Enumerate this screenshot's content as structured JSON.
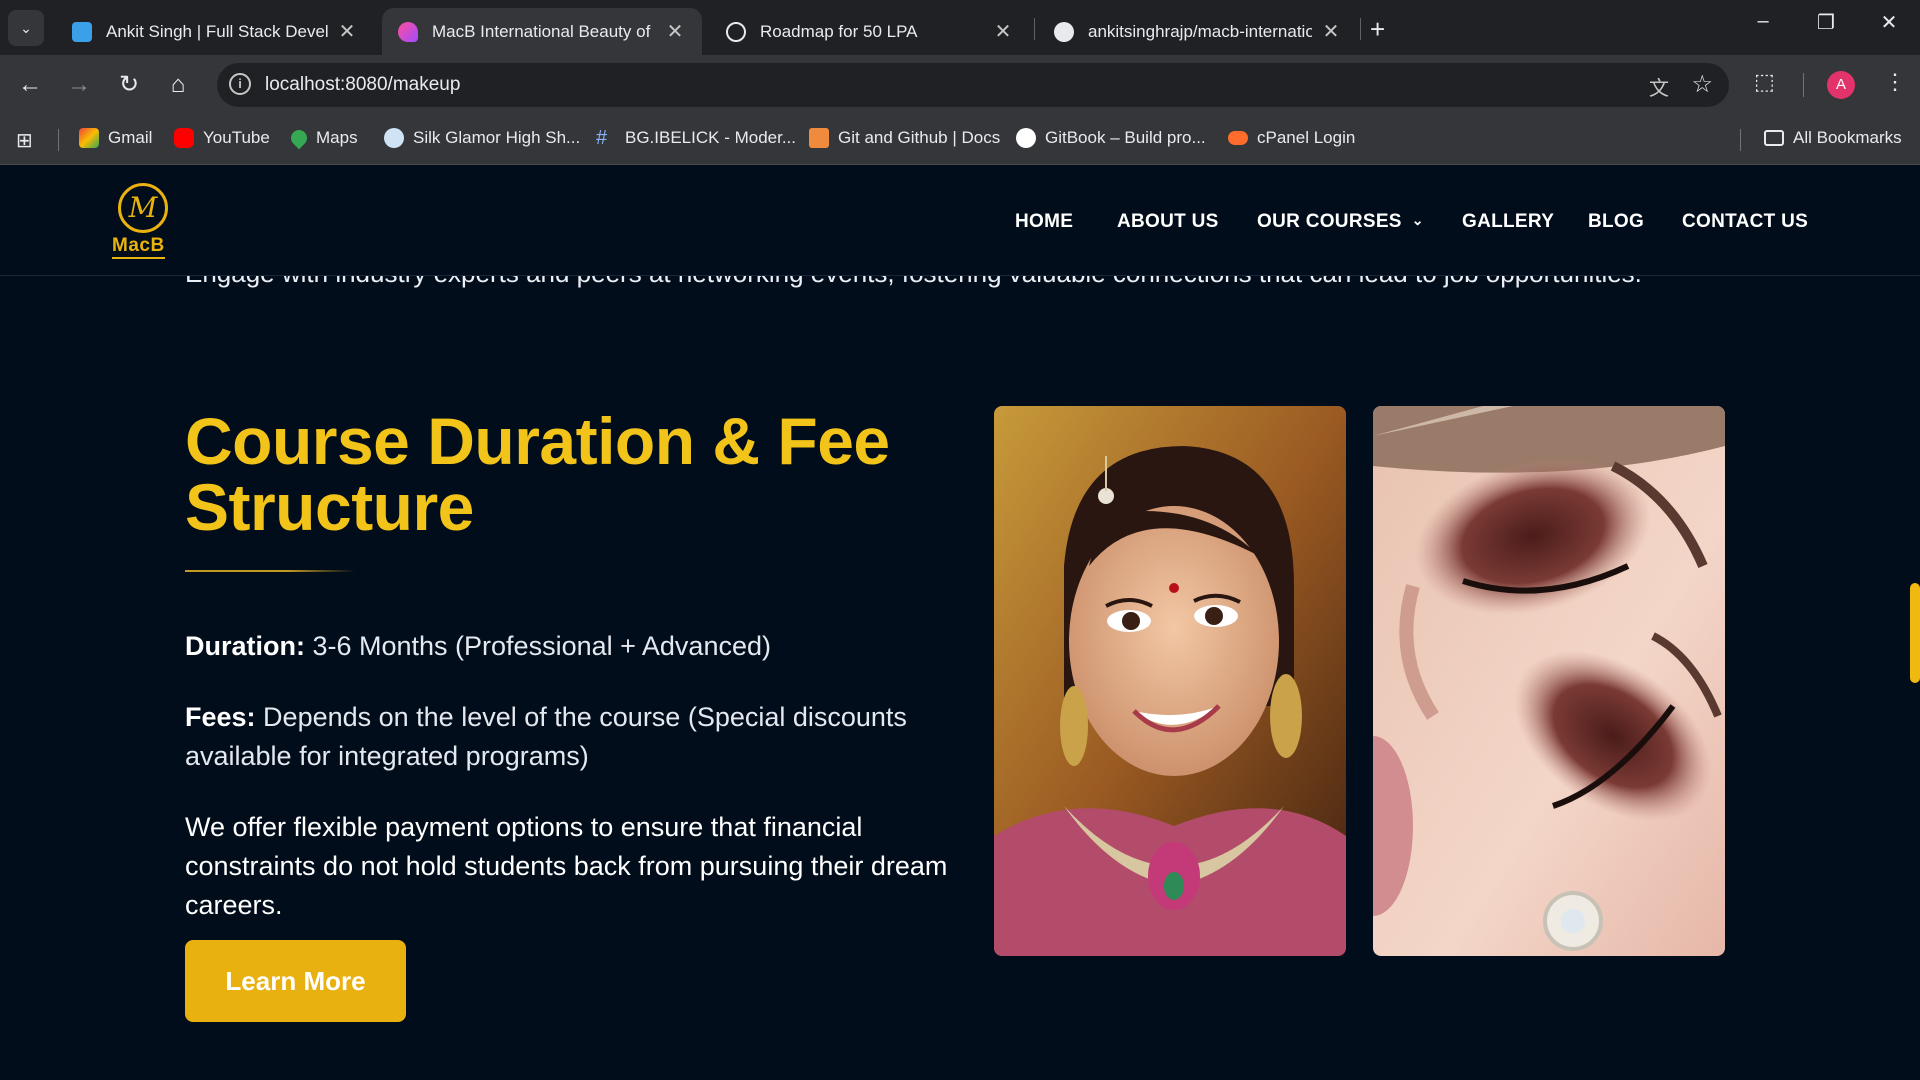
{
  "browser": {
    "tabs": [
      {
        "title": "Ankit Singh | Full Stack Developer",
        "favicon": "portfolio-icon"
      },
      {
        "title": "MacB International Beauty of Sc",
        "favicon": "macb-icon"
      },
      {
        "title": "Roadmap for 50 LPA",
        "favicon": "chatgpt-icon"
      },
      {
        "title": "ankitsinghrajp/macb-internation",
        "favicon": "github-icon"
      }
    ],
    "url": "localhost:8080/makeup",
    "profile_initial": "A",
    "bookmarks": [
      {
        "label": "Gmail",
        "icon": "gmail-icon"
      },
      {
        "label": "YouTube",
        "icon": "youtube-icon"
      },
      {
        "label": "Maps",
        "icon": "maps-icon"
      },
      {
        "label": "Silk Glamor High Sh...",
        "icon": "silk-glamor-icon"
      },
      {
        "label": "BG.IBELICK - Moder...",
        "icon": "hash-icon"
      },
      {
        "label": "Git and Github | Docs",
        "icon": "docs-icon"
      },
      {
        "label": "GitBook – Build pro...",
        "icon": "gitbook-icon"
      },
      {
        "label": "cPanel Login",
        "icon": "cpanel-icon"
      }
    ],
    "all_bookmarks": "All Bookmarks"
  },
  "site": {
    "logo_text": "MacB",
    "nav": {
      "home": "HOME",
      "about": "ABOUT US",
      "courses": "OUR COURSES",
      "gallery": "GALLERY",
      "blog": "BLOG",
      "contact": "CONTACT US"
    }
  },
  "content": {
    "cut_text": "Engage with industry experts and peers at networking events, fostering valuable connections that can lead to job opportunities.",
    "heading": "Course Duration & Fee Structure",
    "duration_label": "Duration:",
    "duration_value": " 3-6 Months (Professional + Advanced)",
    "fees_label": "Fees:",
    "fees_value": " Depends on the level of the course (Special discounts available for integrated programs)",
    "payment_text": "We offer flexible payment options to ensure that financial constraints do not hold students back from pursuing their dream careers.",
    "button_label": "Learn More"
  },
  "colors": {
    "accent": "#e8b10f",
    "heading": "#f2c319",
    "background": "#020d1c"
  }
}
